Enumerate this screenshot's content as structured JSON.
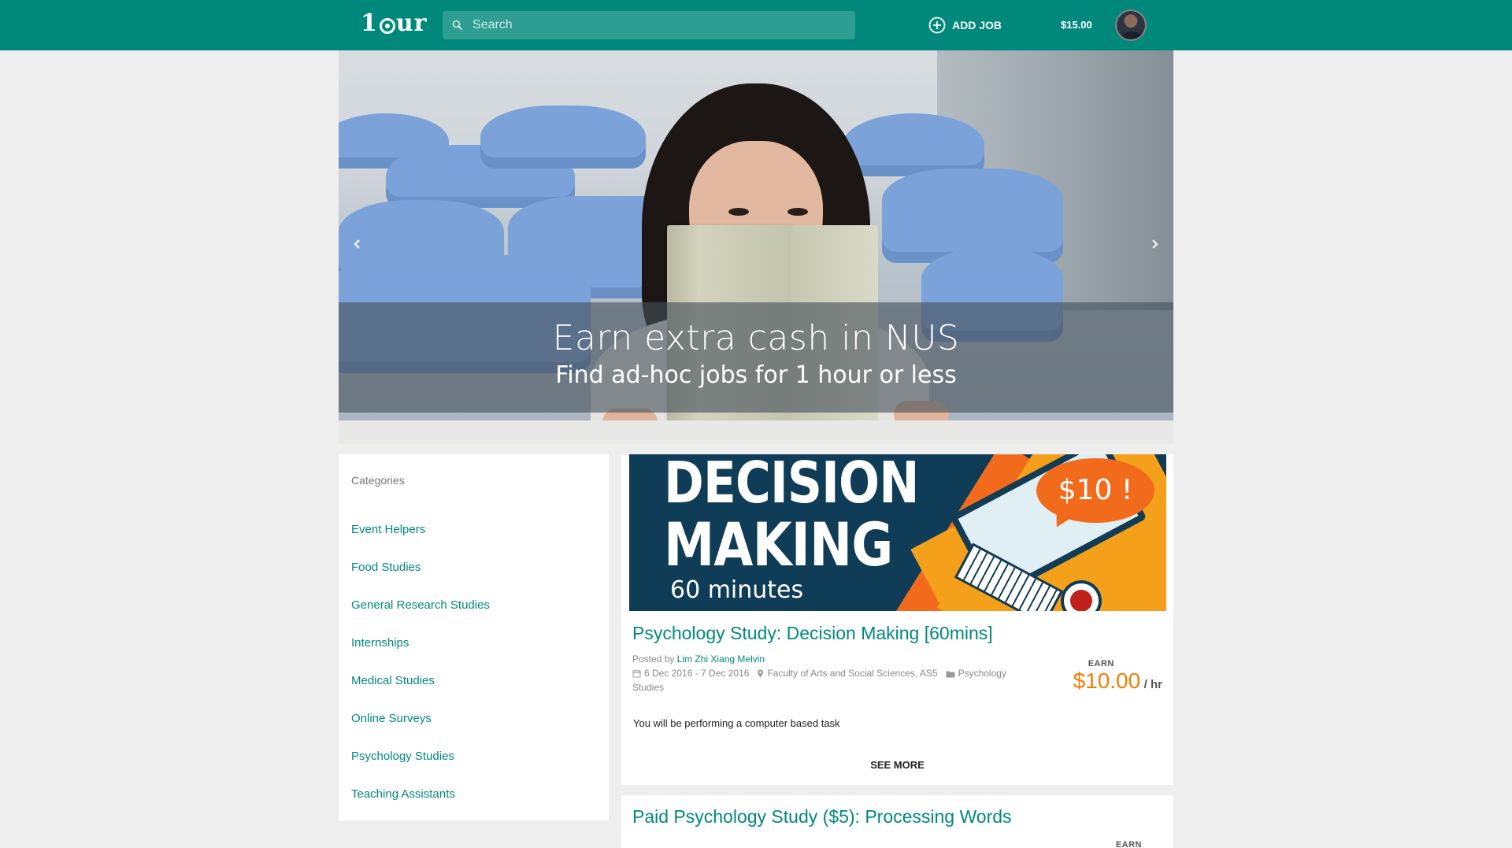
{
  "header": {
    "logo": "1our",
    "search_placeholder": "Search",
    "add_job_label": "ADD JOB",
    "balance": "$15.00",
    "brand_color": "#00897b"
  },
  "hero": {
    "title": "Earn extra cash in NUS",
    "subtitle": "Find ad-hoc jobs for 1 hour or less",
    "prev_icon": "chevron-left-icon",
    "next_icon": "chevron-right-icon"
  },
  "categories": {
    "heading": "Categories",
    "items": [
      "Event Helpers",
      "Food Studies",
      "General Research Studies",
      "Internships",
      "Medical Studies",
      "Online Surveys",
      "Psychology Studies",
      "Teaching Assistants"
    ]
  },
  "jobs": [
    {
      "banner": {
        "line1": "DECISION",
        "line2": "MAKING",
        "line3": "60 minutes",
        "bubble": "$10 !"
      },
      "title": "Psychology Study: Decision Making [60mins]",
      "posted_by_label": "Posted by",
      "poster": "Lim Zhi Xiang Melvin",
      "dates": "6 Dec 2016 - 7 Dec 2016",
      "location": "Faculty of Arts and Social Sciences, AS5",
      "category": "Psychology Studies",
      "earn_label": "EARN",
      "amount": "$10.00",
      "per": "/ hr",
      "description": "You will be performing a computer based task",
      "see_more": "SEE MORE"
    },
    {
      "title": "Paid Psychology Study ($5): Processing Words",
      "earn_label": "EARN"
    }
  ]
}
